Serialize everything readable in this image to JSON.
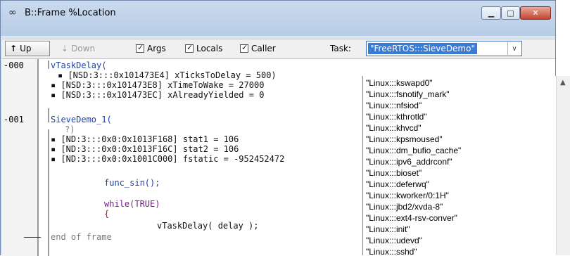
{
  "window": {
    "title": "B::Frame %Location"
  },
  "toolbar": {
    "up_label": "Up",
    "down_label": "Down",
    "args_label": "Args",
    "locals_label": "Locals",
    "caller_label": "Caller",
    "task_label": "Task:",
    "task_value": "\"FreeRTOS:::SieveDemo\""
  },
  "frames": [
    {
      "index": "-000",
      "function": "vTaskDelay(",
      "lines": [
        "▪ [NSD:3:::0x101473E4] xTicksToDelay = 500)",
        "▪ [NSD:3:::0x101473E8] xTimeToWake = 27000",
        "▪ [NSD:3:::0x101473EC] xAlreadyYielded = 0"
      ]
    },
    {
      "index": "-001",
      "function": "SieveDemo_1(",
      "args_line": "?)",
      "lines": [
        "▪ [ND:3:::0x0:0x1013F168] stat1 = 106",
        "▪ [ND:3:::0x0:0x1013F16C] stat2 = 106",
        "▪ [ND:3:::0x0:0x1001C000] fstatic = -952452472"
      ]
    }
  ],
  "source": {
    "line1": "func_sin();",
    "line2": "while(TRUE)",
    "line3": "{",
    "line4": "vTaskDelay( delay );"
  },
  "end_marker": "end of frame",
  "task_list": [
    "\"Linux:::kswapd0\"",
    "\"Linux:::fsnotify_mark\"",
    "\"Linux:::nfsiod\"",
    "\"Linux:::kthrotld\"",
    "\"Linux:::khvcd\"",
    "\"Linux:::kpsmoused\"",
    "\"Linux:::dm_bufio_cache\"",
    "\"Linux:::ipv6_addrconf\"",
    "\"Linux:::bioset\"",
    "\"Linux:::deferwq\"",
    "\"Linux:::kworker/0:1H\"",
    "\"Linux:::jbd2/xvda-8\"",
    "\"Linux:::ext4-rsv-conver\"",
    "\"Linux:::init\"",
    "\"Linux:::udevd\"",
    "\"Linux:::sshd\""
  ]
}
